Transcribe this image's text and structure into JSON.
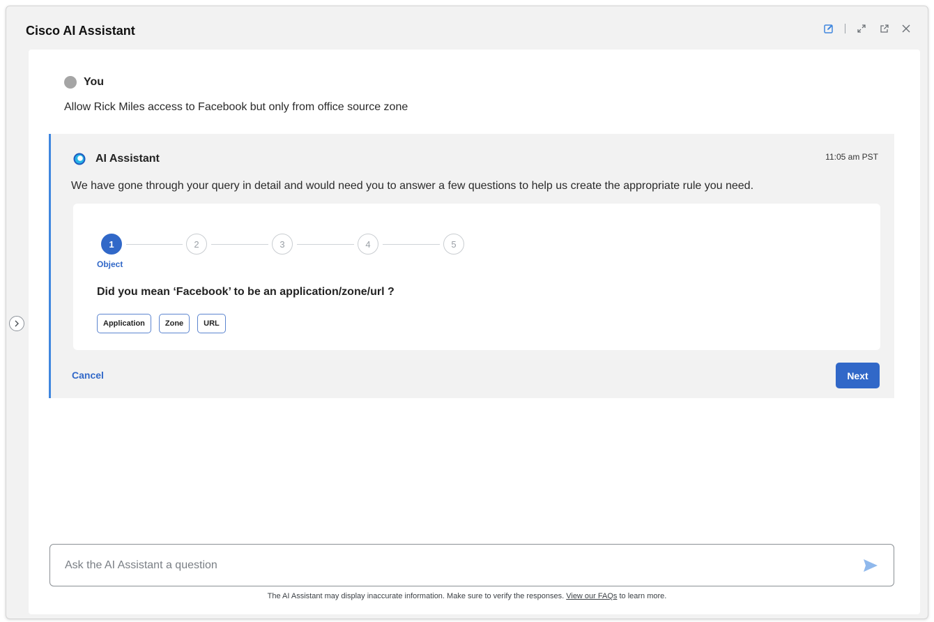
{
  "window": {
    "title": "Cisco AI Assistant",
    "controls": [
      "edit-icon",
      "expand-icon",
      "popout-icon",
      "close-icon"
    ]
  },
  "user_message": {
    "name": "You",
    "text": "Allow Rick Miles access to Facebook but only from office source zone"
  },
  "assistant_message": {
    "name": "AI Assistant",
    "time": "11:05 am PST",
    "text": "We have gone through your query in detail and would need you to answer a few questions to help us create the appropriate rule you need."
  },
  "wizard": {
    "steps": [
      "1",
      "2",
      "3",
      "4",
      "5"
    ],
    "active_step": 1,
    "active_label": "Object",
    "question": "Did you mean ‘Facebook’ to be an application/zone/url ?",
    "choices": [
      "Application",
      "Zone",
      "URL"
    ],
    "cancel_label": "Cancel",
    "next_label": "Next"
  },
  "composer": {
    "placeholder": "Ask the AI Assistant a question"
  },
  "disclaimer": {
    "text_before": "The AI Assistant may display inaccurate information. Make sure to verify the responses.",
    "link": "View our FAQs",
    "text_after": "to learn more."
  },
  "colors": {
    "accent": "#3168c8",
    "card_border": "#3f86de",
    "window_bg": "#f2f2f2"
  }
}
